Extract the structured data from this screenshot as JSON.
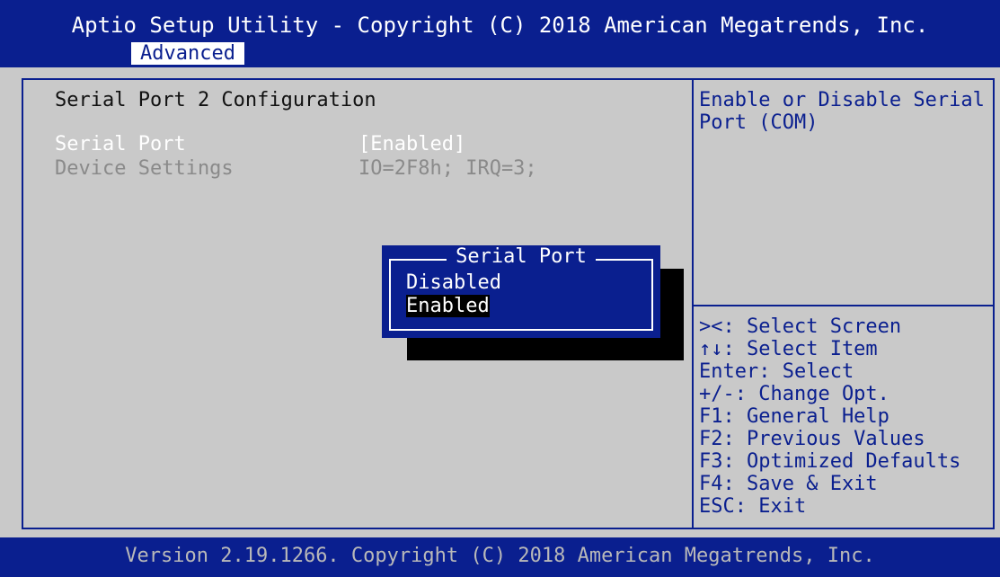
{
  "header": {
    "title": "Aptio Setup Utility - Copyright (C) 2018 American Megatrends, Inc.",
    "active_tab": "Advanced"
  },
  "main": {
    "section_title": "Serial Port 2 Configuration",
    "settings": [
      {
        "label": "Serial Port",
        "value": "[Enabled]",
        "state": "selected"
      },
      {
        "label": "Device Settings",
        "value": "IO=2F8h; IRQ=3;",
        "state": "readonly"
      }
    ]
  },
  "help": {
    "description": "Enable or Disable Serial Port (COM)",
    "key_hints": [
      "><: Select Screen",
      "↑↓: Select Item",
      "Enter: Select",
      "+/-: Change Opt.",
      "F1: General Help",
      "F2: Previous Values",
      "F3: Optimized Defaults",
      "F4: Save & Exit",
      "ESC: Exit"
    ]
  },
  "popup": {
    "title": "Serial Port",
    "options": [
      "Disabled",
      "Enabled"
    ],
    "selected_option": "Enabled"
  },
  "footer": {
    "version_text": "Version 2.19.1266. Copyright (C) 2018 American Megatrends, Inc."
  },
  "colors": {
    "bios_blue": "#0a1f8f",
    "panel_gray": "#c9c9c9",
    "white": "#ffffff",
    "disabled_gray": "#8a8a8a",
    "shadow_black": "#000000"
  }
}
